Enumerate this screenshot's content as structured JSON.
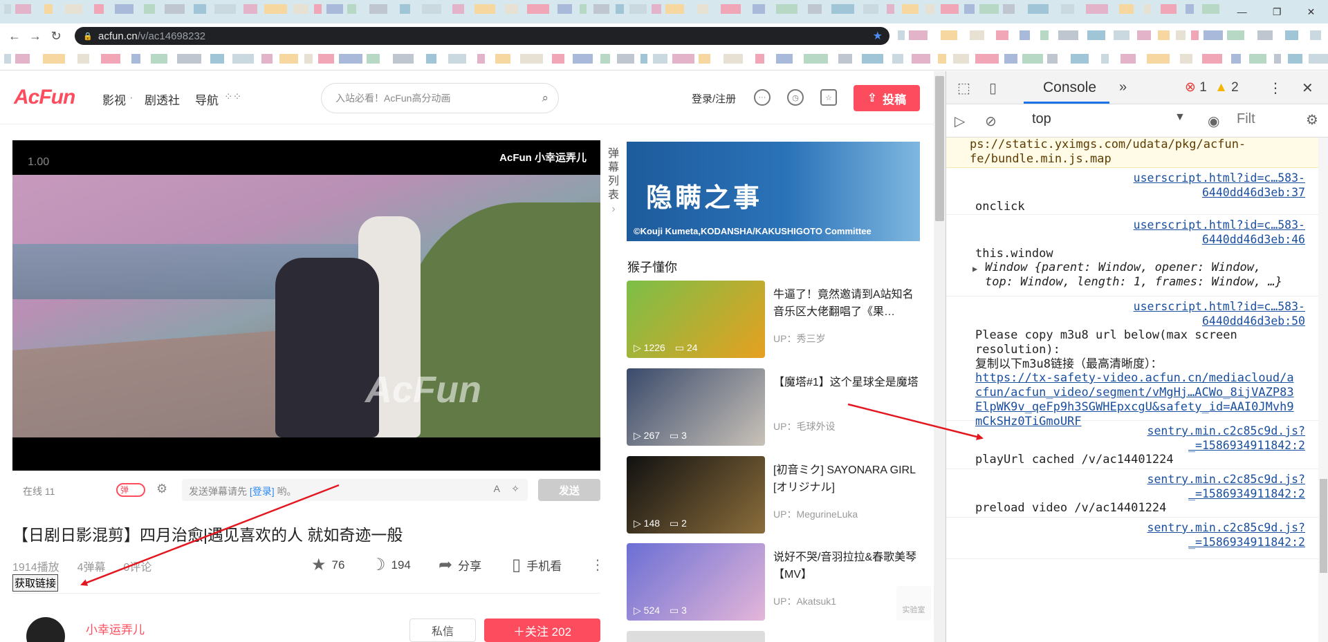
{
  "browser": {
    "url_host": "acfun.cn",
    "url_path": "/v/ac14698232",
    "window_controls": [
      "—",
      "❐",
      "✕"
    ],
    "nav_icons": [
      "back-icon",
      "forward-icon",
      "reload-icon",
      "lock-icon",
      "star-icon"
    ]
  },
  "site": {
    "logo": "AcFun",
    "nav": [
      "影视",
      "剧透社",
      "导航"
    ],
    "search_placeholder": "入站必看！AcFun高分动画",
    "login": "登录/注册",
    "upload": "投稿",
    "accent": "#fd4c5d"
  },
  "player": {
    "speed": "1.00",
    "channel_logo": "AcFun 小幸运弄儿",
    "watermark": "AcFun",
    "online": "在线  11",
    "danmaku_toggle": "弹",
    "danmaku_prefix": "发送弹幕请先",
    "danmaku_login": "[登录]",
    "danmaku_suffix": "哟。",
    "send": "发送"
  },
  "video": {
    "title": "【日剧日影混剪】四月治愈|遇见喜欢的人  就如奇迹一般",
    "plays": "1914播放",
    "danmaku_count": "4弹幕",
    "comments": "0评论",
    "get_link": "获取链接",
    "likes": "76",
    "bananas": "194",
    "share": "分享",
    "mobile": "手机看"
  },
  "uploader": {
    "name": "小幸运弄儿",
    "message": "私信",
    "follow": "＋关注  202"
  },
  "sidebar": {
    "danmaku_list": "弹幕列表",
    "banner_title": "隐瞒之事",
    "banner_copyright": "©Kouji Kumeta,KODANSHA/KAKUSHIGOTO Committee",
    "section_title": "猴子懂你",
    "cards": [
      {
        "title": "牛逼了！竟然邀请到A站知名音乐区大佬翻唱了《果…",
        "up": "UP：秀三岁",
        "plays": "1226",
        "comments": "24",
        "colors": [
          "#7bbf48",
          "#e6a020"
        ]
      },
      {
        "title": "【魔塔#1】这个星球全是魔塔",
        "up": "UP：毛球外设",
        "plays": "267",
        "comments": "3",
        "colors": [
          "#3a4a6b",
          "#c9c2b8"
        ]
      },
      {
        "title": "[初音ミク] SAYONARA GIRL [オリジナル]",
        "up": "UP：MegurineLuka",
        "plays": "148",
        "comments": "2",
        "colors": [
          "#111111",
          "#8b6d3b"
        ]
      },
      {
        "title": "说好不哭/音羽拉拉&春歌美琴【MV】",
        "up": "UP：Akatsuk1",
        "plays": "524",
        "comments": "3",
        "colors": [
          "#6b6fd4",
          "#e4b6d8"
        ]
      }
    ],
    "lab": "实验室"
  },
  "devtools": {
    "tab": "Console",
    "errors": "1",
    "warnings": "2",
    "context": "top",
    "filter": "Filt",
    "log": [
      {
        "text": "ps://static.yximgs.com/udata/pkg/acfun-fe/bundle.min.js.map",
        "kind": "warn"
      },
      {
        "src": "userscript.html?id=c…583-6440dd46d3eb:37",
        "text": "onclick"
      },
      {
        "src": "userscript.html?id=c…583-6440dd46d3eb:46",
        "text": "this.window",
        "obj": "Window {parent: Window, opener: Window, top: Window, length: 1, frames: Window, …}"
      },
      {
        "src": "userscript.html?id=c…583-6440dd46d3eb:50",
        "text": "Please copy m3u8 url below(max screen resolution):",
        "text2": "复制以下m3u8链接（最高清晰度）：",
        "link": "https://tx-safety-video.acfun.cn/mediacloud/acfun/acfun_video/segment/vMgHj…ACWo_8ijVAZP83ElpWK9v_qeFp9h3SGWHEpxcgU&safety_id=AAI0JMvh9mCkSHz0TiGmoURF"
      },
      {
        "src": "sentry.min.c2c85c9d.js?_=1586934911842:2",
        "text": "playUrl cached /v/ac14401224"
      },
      {
        "src": "sentry.min.c2c85c9d.js?_=1586934911842:2",
        "text": "preload video /v/ac14401224"
      },
      {
        "src": "sentry.min.c2c85c9d.js?_=1586934911842:2",
        "text": ""
      }
    ]
  }
}
